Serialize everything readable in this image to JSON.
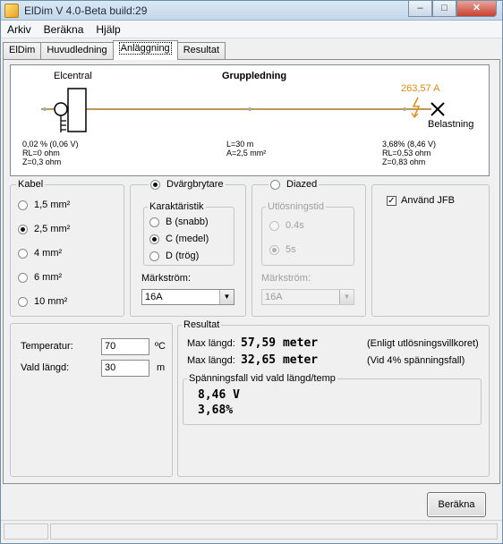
{
  "window": {
    "title": "ElDim V 4.0-Beta build:29",
    "minimize": "–",
    "maximize": "□",
    "close": "✕"
  },
  "menu": [
    "Arkiv",
    "Beräkna",
    "Hjälp"
  ],
  "tabs": [
    "ElDim",
    "Huvudledning",
    "Anläggning",
    "Resultat"
  ],
  "active_tab": "Anläggning",
  "diagram": {
    "heading": "Gruppledning",
    "elcentral": "Elcentral",
    "load": "Belastning",
    "current": "263,57 A",
    "left_lines": [
      "0,02 % (0,06 V)",
      "RL=0 ohm",
      "Z=0,3 ohm"
    ],
    "mid_lines": [
      "L=30 m",
      "A=2,5 mm²"
    ],
    "right_lines": [
      "3,68% (8,46 V)",
      "RL=0,53 ohm",
      "Z=0,83 ohm"
    ],
    "colors": {
      "line": "#a07820",
      "current": "#e08a10"
    }
  },
  "kabel": {
    "title": "Kabel",
    "options": [
      "1,5 mm²",
      "2,5 mm²",
      "4 mm²",
      "6 mm²",
      "10 mm²"
    ],
    "selected": "2,5 mm²"
  },
  "dvarg": {
    "title": "Dvärgbrytare",
    "karakteristik_title": "Karaktäristik",
    "options": [
      "B  (snabb)",
      "C  (medel)",
      "D  (trög)"
    ],
    "selected": "C  (medel)",
    "markstrom_label": "Märkström:",
    "markstrom_value": "16A"
  },
  "diazed": {
    "title": "Diazed",
    "utlosning_title": "Utlösningstid",
    "options": [
      "0.4s",
      "5s"
    ],
    "selected": "5s",
    "markstrom_label": "Märkström:",
    "markstrom_value": "16A"
  },
  "jfb": {
    "label": "Använd JFB",
    "checked": true
  },
  "inputs": {
    "temperatur_label": "Temperatur:",
    "temperatur_value": "70",
    "temperatur_unit": "ºC",
    "langd_label": "Vald längd:",
    "langd_value": "30",
    "langd_unit": "m"
  },
  "resultat": {
    "title": "Resultat",
    "row1_label": "Max längd:",
    "row1_value": "57,59 meter",
    "row1_note": "(Enligt utlösningsvillkoret)",
    "row2_label": "Max längd:",
    "row2_value": "32,65 meter",
    "row2_note": "(Vid 4% spänningsfall)",
    "spf_title": "Spänningsfall vid vald längd/temp",
    "spf_v": "8,46 V",
    "spf_pct": "3,68%"
  },
  "berakna_button": "Beräkna"
}
